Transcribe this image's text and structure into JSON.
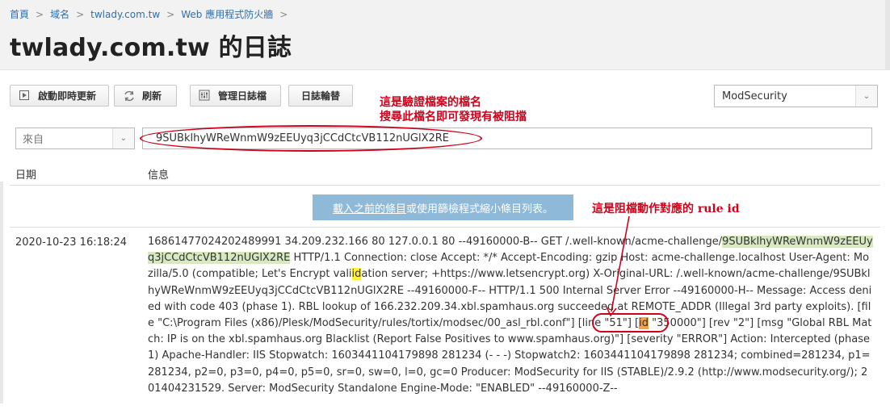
{
  "breadcrumb": {
    "items": [
      "首頁",
      "域名",
      "twlady.com.tw",
      "Web 應用程式防火牆"
    ],
    "separator": ">"
  },
  "page_title": "twlady.com.tw 的日誌",
  "toolbar": {
    "live_update_label": "啟動即時更新",
    "refresh_label": "刷新",
    "manage_logs_label": "管理日誌檔",
    "log_rotation_label": "日誌輪替"
  },
  "engine_select": {
    "value": "ModSecurity"
  },
  "filter": {
    "source_placeholder": "來自",
    "search_value": "9SUBklhyWReWnmW9zEEUyq3jCCdCtcVB112nUGlX2RE"
  },
  "annotations": {
    "filename_line1": "這是驗證檔案的檔名",
    "filename_line2": "搜尋此檔名即可發現有被阻擋",
    "rule_id_note": "這是阻檔動作對應的 rule id"
  },
  "table": {
    "col_date": "日期",
    "col_message": "信息",
    "load_more_link": "載入之前的條目",
    "load_more_rest": " 或使用篩檢程式縮小條目列表。"
  },
  "entry": {
    "date": "2020-10-23 16:18:24",
    "msg_p1": "16861477024202489991 34.209.232.166 80 127.0.0.1 80 --49160000-B-- GET /.well-known/acme-challenge/",
    "msg_hl1": "9SUBklhyWReWnmW9zEEUyq3jCCdCtcVB112nUGlX2RE",
    "msg_p2": " HTTP/1.1 Connection: close Accept: */* Accept-Encoding: gzip Host: acme-challenge.localhost User-Agent: Mozilla/5.0 (compatible; Let's Encrypt vali",
    "msg_id1": "id",
    "msg_p3": "ation server; +https://www.letsencrypt.org) X-Original-URL: /.well-known/acme-challenge/9SUBklhyWReWnmW9zEEUyq3jCCdCtcVB112nUGlX2RE --49160000-F-- HTTP/1.1 500 Internal Server Error --49160000-H-- Message: Access denied with code 403 (phase 1). RBL lookup of 166.232.209.34.xbl.spamhaus.org succeeded at REMOTE_ADDR (Illegal 3rd party exploits). [file \"C:\\Program Files (x86)/Plesk/ModSecurity/rules/tortix/modsec/00_asl_rbl.conf\"] [line \"51\"] [",
    "msg_id2": "id",
    "msg_p4": " \"350000\"] [rev \"2\"] [msg \"Global RBL Match: IP is on the xbl.spamhaus.org Blacklist (Report False Positives to www.spamhaus.org)\"] [severity \"ERROR\"] Action: Intercepted (phase 1) Apache-Handler: IIS Stopwatch: 1603441104179898 281234 (- - -) Stopwatch2: 1603441104179898 281234; combined=281234, p1=281234, p2=0, p3=0, p4=0, p5=0, sr=0, sw=0, l=0, gc=0 Producer: ModSecurity for IIS (STABLE)/2.9.2 (http://www.modsecurity.org/); 201404231529. Server: ModSecurity Standalone Engine-Mode: \"ENABLED\" --49160000-Z--"
  },
  "colors": {
    "link": "#2f6fab",
    "annotation_red": "#d0021b",
    "load_more_bg": "#8fb9d8",
    "highlight_green": "#d8e8c0",
    "highlight_yellow": "#ffef3b",
    "highlight_orange": "#f6a24c"
  },
  "icons": {
    "live_update": "play-icon",
    "refresh": "refresh-icon",
    "manage_logs": "log-settings-icon",
    "dropdown": "chevron-down-icon"
  }
}
